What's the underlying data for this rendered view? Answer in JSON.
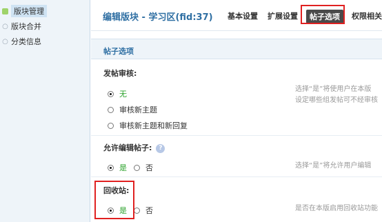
{
  "sidebar": {
    "items": [
      {
        "label": "版块管理",
        "active": true
      },
      {
        "label": "版块合并",
        "active": false
      },
      {
        "label": "分类信息",
        "active": false
      }
    ]
  },
  "header": {
    "title": "编辑版块 - 学习区(fid:37)",
    "tabs": [
      {
        "label": "基本设置",
        "active": false
      },
      {
        "label": "扩展设置",
        "active": false
      },
      {
        "label": "帖子选项",
        "active": true
      },
      {
        "label": "权限相关",
        "active": false
      }
    ]
  },
  "section": {
    "title": "帖子选项"
  },
  "settings": {
    "audit": {
      "label": "发帖审核:",
      "options": [
        "无",
        "审核新主题",
        "审核新主题和新回复"
      ],
      "selected": "无",
      "desc_line1": "选择“是”将使用户在本版",
      "desc_line2": "设定哪些组发帖可不经审核"
    },
    "edit": {
      "label": "允许编辑帖子:",
      "help_icon": "?",
      "options": [
        "是",
        "否"
      ],
      "selected": "是",
      "desc": "选择“是”将允许用户编辑"
    },
    "recycle": {
      "label": "回收站:",
      "options": [
        "是",
        "否"
      ],
      "selected": "是",
      "desc": "是否在本版启用回收站功能"
    }
  },
  "colors": {
    "accent": "#2f6fa3",
    "selected_text": "#2aa12a",
    "highlight_box": "#e02020"
  }
}
